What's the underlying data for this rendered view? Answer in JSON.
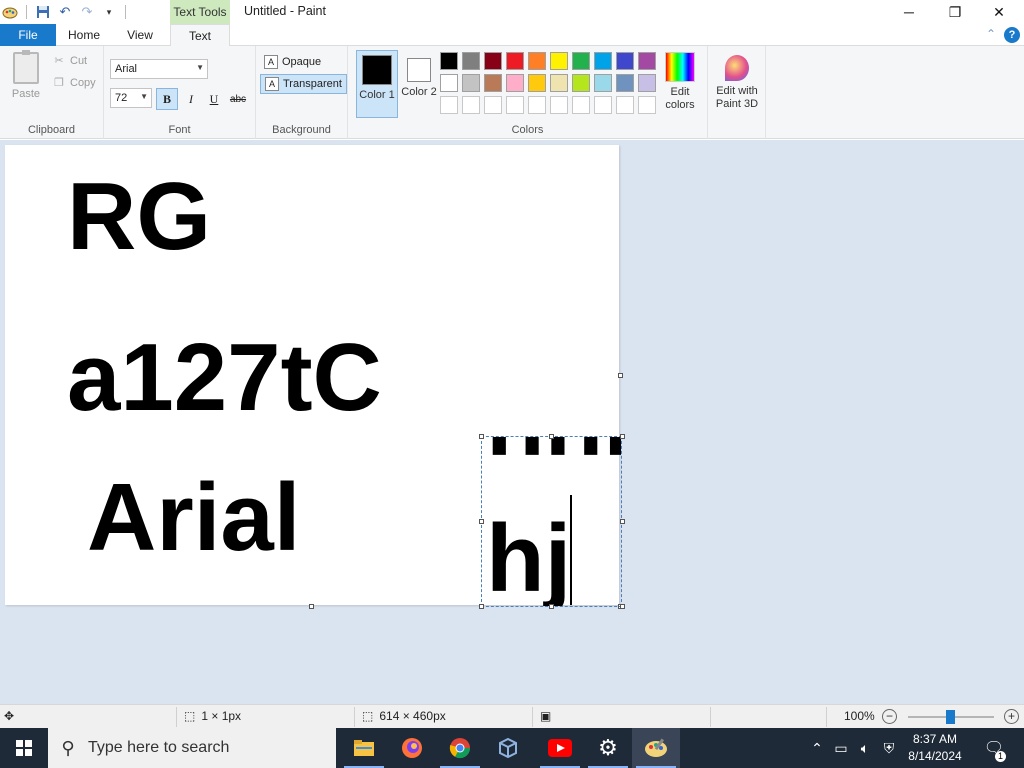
{
  "window": {
    "title": "Untitled - Paint",
    "context_tab": "Text Tools",
    "minimize_glyph": "─",
    "maximize_glyph": "❐",
    "close_glyph": "✕"
  },
  "quick_access": {
    "icons": [
      "paint-app-icon",
      "save-icon",
      "undo-icon",
      "redo-icon",
      "customize-quick-access-icon"
    ]
  },
  "ribbon_tabs": {
    "file": "File",
    "home": "Home",
    "view": "View",
    "text": "Text",
    "collapse_glyph": "⌃",
    "help_glyph": "?"
  },
  "clipboard": {
    "paste": "Paste",
    "cut": "Cut",
    "copy": "Copy",
    "label": "Clipboard"
  },
  "font": {
    "family": "Arial",
    "size": "72",
    "bold": "B",
    "italic": "I",
    "underline": "U",
    "strikethrough": "abc",
    "label": "Font",
    "bold_active": true
  },
  "background": {
    "opaque": "Opaque",
    "transparent": "Transparent",
    "label": "Background",
    "selected": "transparent"
  },
  "colors": {
    "color1_label": "Color 1",
    "color2_label": "Color 2",
    "color1": "#000000",
    "color2": "#ffffff",
    "edit_colors": "Edit colors",
    "edit_paint3d": "Edit with Paint 3D",
    "label": "Colors",
    "palette_row1": [
      "#000000",
      "#7f7f7f",
      "#880015",
      "#ed1c24",
      "#ff7f27",
      "#fff200",
      "#22b14c",
      "#00a2e8",
      "#3f48cc",
      "#a349a4"
    ],
    "palette_row2": [
      "#ffffff",
      "#c3c3c3",
      "#b97a57",
      "#ffaec9",
      "#ffc90e",
      "#efe4b0",
      "#b5e61d",
      "#99d9ea",
      "#7092be",
      "#c8bfe7"
    ],
    "palette_row3": [
      "#ffffff",
      "#ffffff",
      "#ffffff",
      "#ffffff",
      "#ffffff",
      "#ffffff",
      "#ffffff",
      "#ffffff",
      "#ffffff",
      "#ffffff"
    ]
  },
  "canvas": {
    "line1": "RG",
    "line2": "a127tC",
    "line3": "Arial",
    "textbox_line1": "hhh",
    "textbox_line2": "hj"
  },
  "status": {
    "selection_size": "1 × 1px",
    "canvas_size": "614 × 460px",
    "zoom": "100%",
    "zoom_level": 1.0
  },
  "taskbar": {
    "search_placeholder": "Type here to search",
    "apps": [
      "file-explorer-icon",
      "firefox-icon",
      "chrome-icon",
      "virtualbox-icon",
      "youtube-icon",
      "settings-icon",
      "paint-icon"
    ],
    "time": "8:37 AM",
    "date": "8/14/2024",
    "notification_count": "1"
  }
}
